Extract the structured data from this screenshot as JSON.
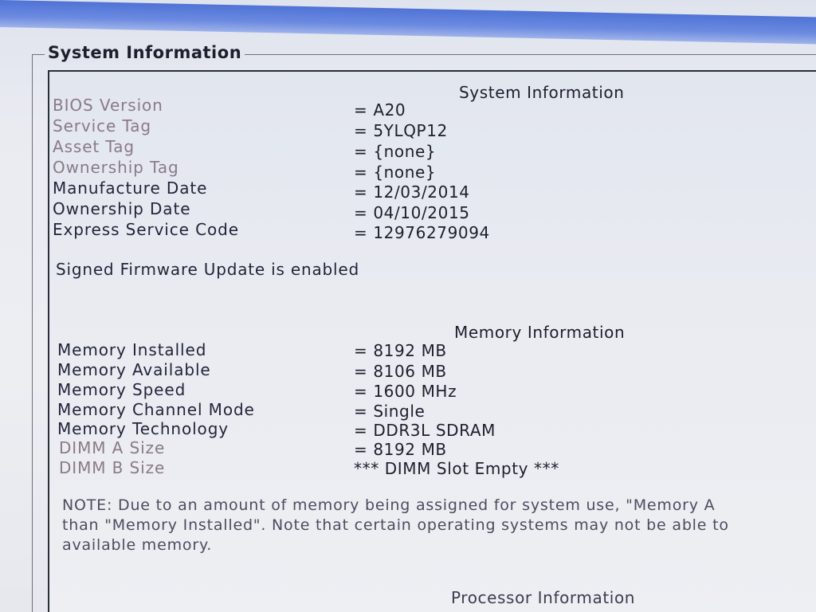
{
  "frame": {
    "group_title": "System Information"
  },
  "system_info": {
    "heading": "System Information",
    "rows": [
      {
        "label": "BIOS Version",
        "value": "= A20"
      },
      {
        "label": "Service Tag",
        "value": "= 5YLQP12"
      },
      {
        "label": "Asset Tag",
        "value": "= {none}"
      },
      {
        "label": "Ownership Tag",
        "value": "= {none}"
      },
      {
        "label": "Manufacture Date",
        "value": "= 12/03/2014"
      },
      {
        "label": "Ownership Date",
        "value": "= 04/10/2015"
      },
      {
        "label": "Express Service Code",
        "value": "= 12976279094"
      }
    ],
    "firmware_status": "Signed Firmware Update is enabled"
  },
  "memory_info": {
    "heading": "Memory Information",
    "rows": [
      {
        "label": "Memory Installed",
        "value": "= 8192 MB"
      },
      {
        "label": "Memory Available",
        "value": "= 8106 MB"
      },
      {
        "label": "Memory Speed",
        "value": "= 1600 MHz"
      },
      {
        "label": "Memory Channel Mode",
        "value": "= Single"
      },
      {
        "label": "Memory Technology",
        "value": "= DDR3L SDRAM"
      },
      {
        "label": "DIMM A Size",
        "value": "= 8192 MB"
      },
      {
        "label": "DIMM B Size",
        "value": "*** DIMM Slot Empty ***"
      }
    ],
    "note_lines": [
      "NOTE: Due to an amount of memory being assigned for system use, \"Memory A",
      "than \"Memory Installed\". Note that certain operating systems may not be able to",
      "available memory."
    ]
  },
  "processor_info": {
    "heading": "Processor Information"
  },
  "colors": {
    "title_bar": "#5b7ddb",
    "background": "#eceef2",
    "dim_label": "#8a7a86",
    "text": "#1c1f2c"
  }
}
